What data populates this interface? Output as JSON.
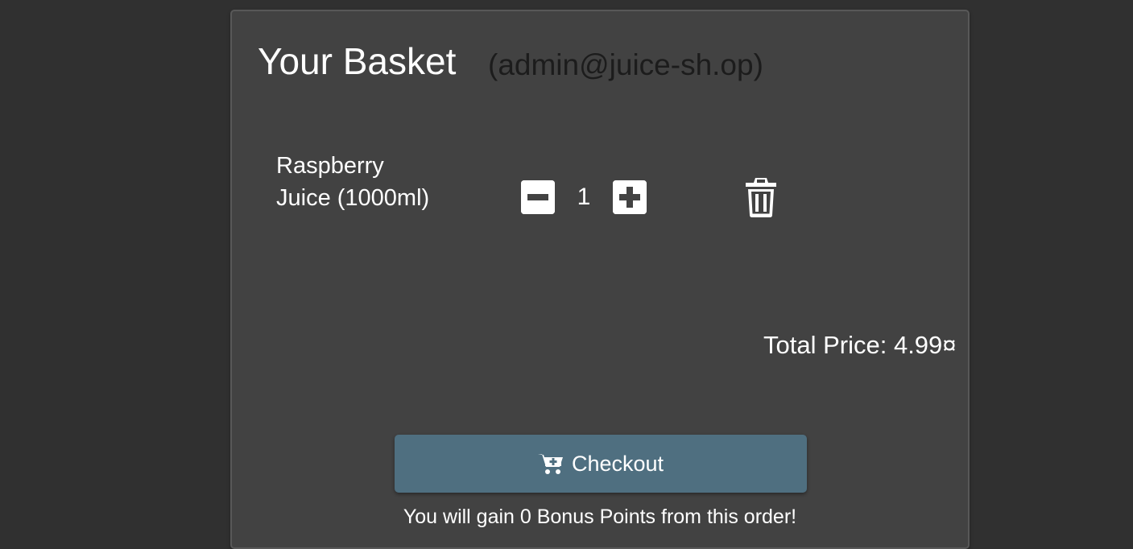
{
  "basket": {
    "title": "Your Basket",
    "user": "(admin@juice-sh.op)",
    "items": [
      {
        "name": "Raspberry Juice (1000ml)",
        "quantity": "1"
      }
    ],
    "total_price": "Total Price: 4.99¤",
    "checkout_label": "Checkout",
    "bonus_text": "You will gain 0 Bonus Points from this order!"
  },
  "icons": {
    "decrease": "minus-square-icon",
    "increase": "plus-square-icon",
    "delete": "trash-icon",
    "checkout": "cart-plus-icon"
  },
  "colors": {
    "background": "#303030",
    "card": "#424242",
    "checkout_button": "#4f6f80",
    "subtitle": "#1c1c1c"
  }
}
